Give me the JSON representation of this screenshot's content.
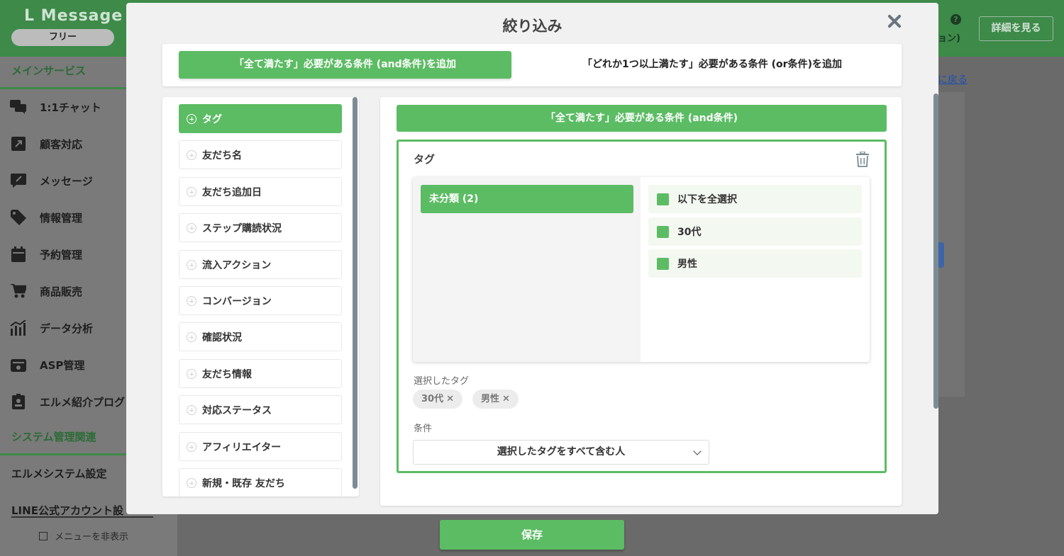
{
  "app": {
    "logo": "L Message",
    "plan": "フリー",
    "top_fragment": "ョン)",
    "detail_button": "詳細を見る",
    "back_link_fragment": "に戻る"
  },
  "sidebar": {
    "main_section": "メインサービス",
    "items": [
      {
        "label": "1:1チャット",
        "icon": "chat-icon"
      },
      {
        "label": "顧客対応",
        "icon": "external-link-icon"
      },
      {
        "label": "メッセージ",
        "icon": "message-edit-icon"
      },
      {
        "label": "情報管理",
        "icon": "tag-icon"
      },
      {
        "label": "予約管理",
        "icon": "calendar-icon"
      },
      {
        "label": "商品販売",
        "icon": "cart-icon"
      },
      {
        "label": "データ分析",
        "icon": "chart-icon"
      },
      {
        "label": "ASP管理",
        "icon": "wallet-icon"
      },
      {
        "label": "エルメ紹介プログ",
        "icon": "badge-icon"
      }
    ],
    "system_section": "システム管理関連",
    "system_settings": "エルメシステム設定",
    "line_account": "LINE公式アカウント設",
    "hide_menu": "メニューを非表示"
  },
  "modal": {
    "title": "絞り込み",
    "mode_and": "「全て満たす」必要がある条件 (and条件)を追加",
    "mode_or": "「どれか1つ以上満たす」必要がある条件 (or条件)を追加",
    "conditions": [
      "タグ",
      "友だち名",
      "友だち追加日",
      "ステップ購読状況",
      "流入アクション",
      "コンバージョン",
      "確認状況",
      "友だち情報",
      "対応ステータス",
      "アフィリエイター",
      "新規・既存 友だち"
    ],
    "group_header": "「全て満たす」必要がある条件 (and条件)",
    "condition_box_label": "タグ",
    "folder": "未分類 (2)",
    "tag_options": [
      "以下を全選択",
      "30代",
      "男性"
    ],
    "selected_tags_label": "選択したタグ",
    "selected_tags": [
      "30代",
      "男性"
    ],
    "remove_mark": "✕",
    "condition_label": "条件",
    "condition_value": "選択したタグをすべて含む人",
    "save_button": "保存"
  },
  "colors": {
    "accent_green": "#5cbc64",
    "header_green": "#3d8a49"
  }
}
